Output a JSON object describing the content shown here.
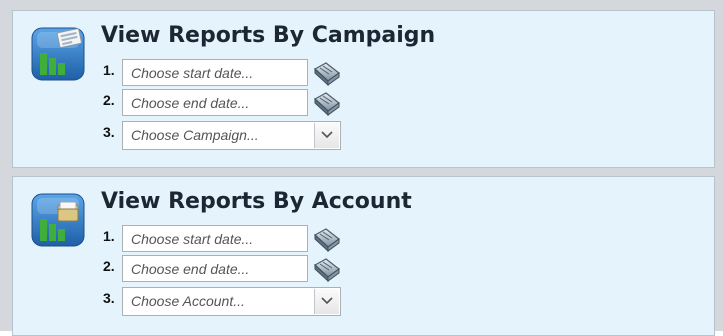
{
  "sections": [
    {
      "title": "View Reports By Campaign",
      "icon": "campaign-report-icon",
      "steps": [
        {
          "number": "1.",
          "placeholder": "Choose start date...",
          "icon": "calendar-icon"
        },
        {
          "number": "2.",
          "placeholder": "Choose end date...",
          "icon": "calendar-icon"
        },
        {
          "number": "3.",
          "selected": "Choose Campaign...",
          "icon": "chevron-down-icon"
        }
      ]
    },
    {
      "title": "View Reports By Account",
      "icon": "account-report-icon",
      "steps": [
        {
          "number": "1.",
          "placeholder": "Choose start date...",
          "icon": "calendar-icon"
        },
        {
          "number": "2.",
          "placeholder": "Choose end date...",
          "icon": "calendar-icon"
        },
        {
          "number": "3.",
          "selected": "Choose Account...",
          "icon": "chevron-down-icon"
        }
      ]
    }
  ],
  "colors": {
    "panel_background": "#e5f3fc",
    "panel_border": "#b7c3cc",
    "icon_blue": "#2f7fc9",
    "chart_green": "#3fae3a",
    "title_text": "#1c2733"
  }
}
